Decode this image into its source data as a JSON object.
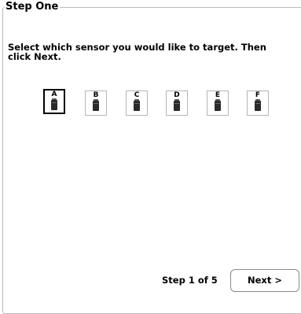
{
  "group": {
    "title": "Step One"
  },
  "instructions": "Select which sensor you would like to target.  Then click Next.",
  "sensors": [
    {
      "label": "A",
      "selected": true,
      "icon": "sensor-device-icon"
    },
    {
      "label": "B",
      "selected": false,
      "icon": "sensor-device-icon"
    },
    {
      "label": "C",
      "selected": false,
      "icon": "sensor-device-icon"
    },
    {
      "label": "D",
      "selected": false,
      "icon": "sensor-device-icon"
    },
    {
      "label": "E",
      "selected": false,
      "icon": "sensor-device-icon"
    },
    {
      "label": "F",
      "selected": false,
      "icon": "sensor-device-icon"
    }
  ],
  "footer": {
    "step_indicator": "Step 1 of 5",
    "next_label": "Next >"
  }
}
